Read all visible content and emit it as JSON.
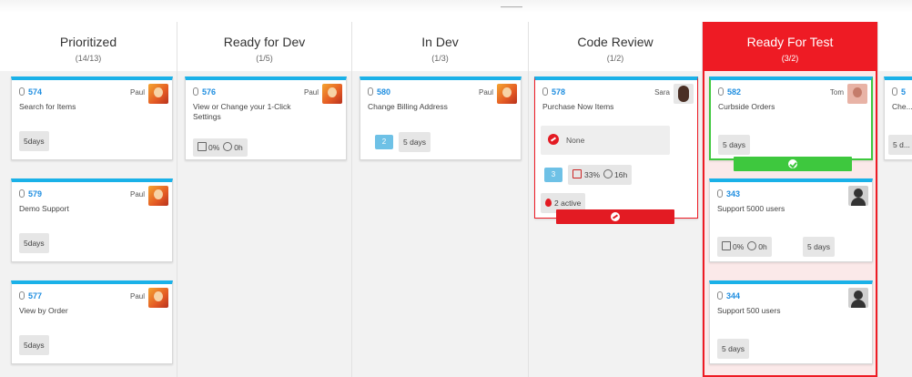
{
  "board": {
    "header_mark": "———",
    "columns": [
      {
        "title": "Prioritized",
        "count": "(14/13)"
      },
      {
        "title": "Ready for Dev",
        "count": "(1/5)"
      },
      {
        "title": "In Dev",
        "count": "(1/3)"
      },
      {
        "title": "Code Review",
        "count": "(1/2)"
      },
      {
        "title": "Ready For Test",
        "count": "(3/2)"
      }
    ]
  },
  "cards": {
    "c574": {
      "id": "574",
      "owner": "Paul",
      "desc": "Search for Items",
      "duration": "5days"
    },
    "c579": {
      "id": "579",
      "owner": "Paul",
      "desc": "Demo Support",
      "duration": "5days"
    },
    "c577": {
      "id": "577",
      "owner": "Paul",
      "desc": "View by Order",
      "duration": "5days"
    },
    "c576": {
      "id": "576",
      "owner": "Paul",
      "desc": "View or Change your 1-Click Settings",
      "progress": "0%",
      "time": "0h"
    },
    "c580": {
      "id": "580",
      "owner": "Paul",
      "desc": "Change Billing Address",
      "tasks": "2",
      "duration": "5 days"
    },
    "c578": {
      "id": "578",
      "owner": "Sara",
      "desc": "Purchase Now Items",
      "blocked_reason": "None",
      "tasks": "3",
      "progress": "33%",
      "time": "16h",
      "impediments": "2 active"
    },
    "c582": {
      "id": "582",
      "owner": "Tom",
      "desc": "Curbside Orders",
      "duration": "5 days"
    },
    "c343": {
      "id": "343",
      "owner": "",
      "desc": "Support 5000 users",
      "progress": "0%",
      "time": "0h",
      "duration": "5 days"
    },
    "c344": {
      "id": "344",
      "owner": "",
      "desc": "Support 500 users",
      "duration": "5 days"
    },
    "cx": {
      "id": "5",
      "desc": "Che... PBV...",
      "duration": "5 d..."
    }
  },
  "colors": {
    "accent": "#1ab1e8",
    "alert": "#ee1b24",
    "done": "#3ec83e",
    "id_text": "#1f8ee0"
  }
}
